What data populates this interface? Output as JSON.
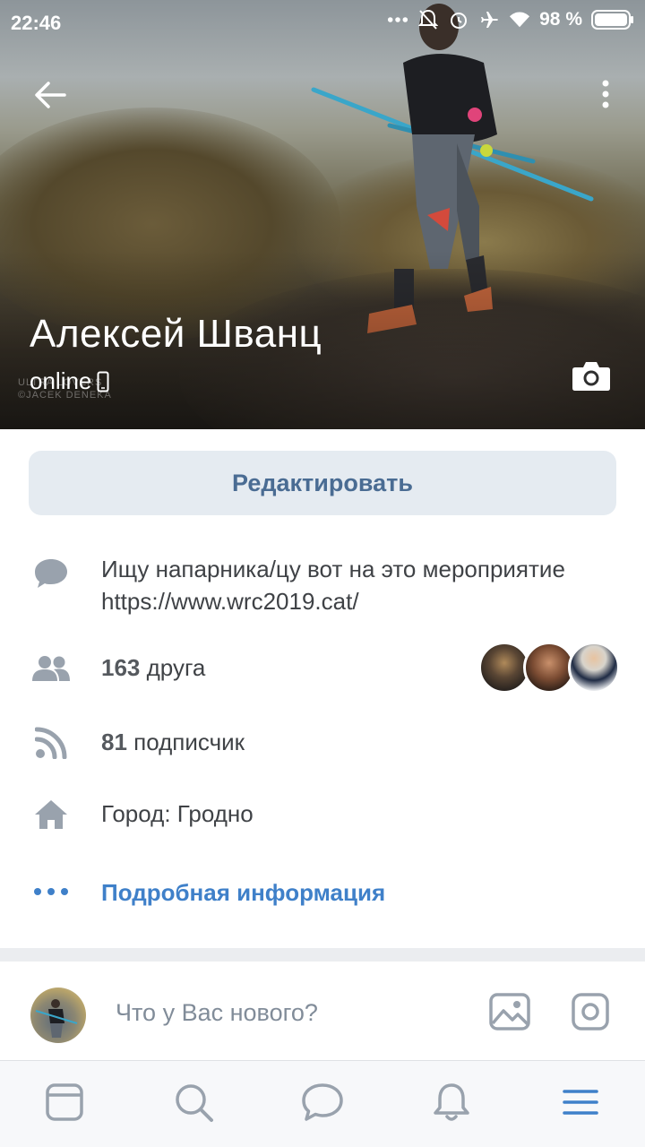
{
  "status_bar": {
    "time": "22:46",
    "battery": "98 %"
  },
  "profile": {
    "name": "Алексей Шванц",
    "status": "online"
  },
  "actions": {
    "edit_label": "Редактировать"
  },
  "info": {
    "status_text": "Ищу напарника/цу вот на это мероприятие https://www.wrc2019.cat/",
    "friends_count": "163",
    "friends_label": "друга",
    "followers_count": "81",
    "followers_label": "подписчик",
    "city": "Город: Гродно",
    "more_label": "Подробная информация"
  },
  "composer": {
    "placeholder": "Что у Вас нового?"
  },
  "colors": {
    "accent": "#3f80c9",
    "button_bg": "#e5ebf1",
    "button_text": "#4a6c93",
    "icon_gray": "#99a2ad"
  }
}
